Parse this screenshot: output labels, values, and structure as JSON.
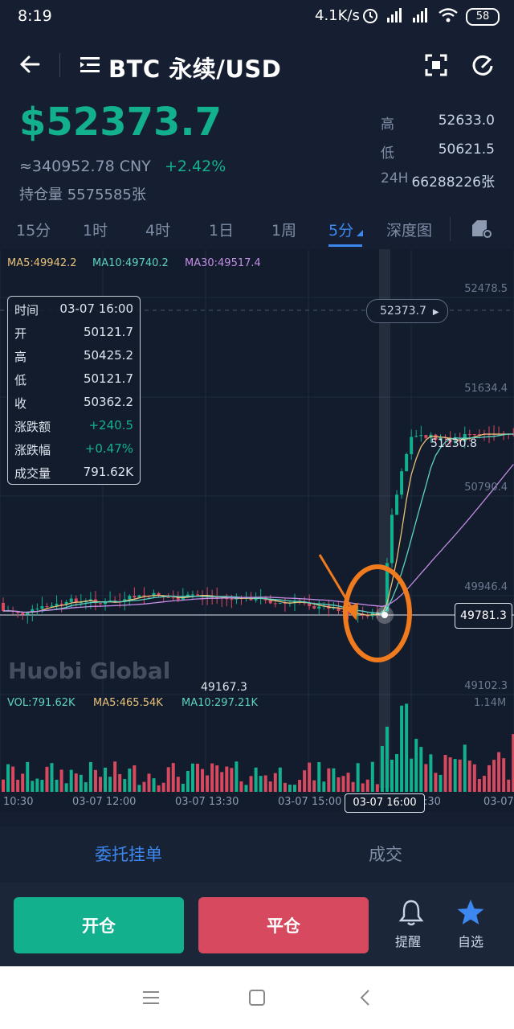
{
  "status": {
    "time": "8:19",
    "net_speed": "4.1K/s",
    "battery": "58"
  },
  "header": {
    "title": "BTC 永续/USD"
  },
  "ticker": {
    "price": "$52373.7",
    "cny": "≈340952.78 CNY",
    "change": "+2.42%",
    "open_interest": "持仓量 5575585张",
    "high_label": "高",
    "high": "52633.0",
    "low_label": "低",
    "low": "50621.5",
    "vol_label": "24H",
    "vol": "66288226张"
  },
  "tabs": [
    {
      "label": "15分"
    },
    {
      "label": "1时"
    },
    {
      "label": "4时"
    },
    {
      "label": "1日"
    },
    {
      "label": "1周"
    },
    {
      "label": "5分"
    },
    {
      "label": "深度图"
    }
  ],
  "ma": {
    "ma5": "MA5:49942.2",
    "ma10": "MA10:49740.2",
    "ma30": "MA30:49517.4"
  },
  "vol_ma": {
    "vol": "VOL:791.62K",
    "ma5": "MA5:465.54K",
    "ma10": "MA10:297.21K"
  },
  "axis": {
    "price_ticks": [
      "52478.5",
      "51634.4",
      "50790.4",
      "49946.4",
      "49102.3"
    ],
    "vol_max": "1.14M",
    "time_ticks": [
      "10:30",
      "03-07 12:00",
      "03-07 13:30",
      "03-07 15:00",
      ":30",
      "03-07"
    ],
    "cursor_time": "03-07 16:00",
    "cursor_price": "49781.3",
    "last_price": "52373.7",
    "max_label": "51230.8",
    "min_label": "49167.3"
  },
  "watermark": "Huobi Global",
  "info": [
    {
      "k": "时间",
      "v": "03-07 16:00",
      "g": false
    },
    {
      "k": "开",
      "v": "50121.7",
      "g": false
    },
    {
      "k": "高",
      "v": "50425.2",
      "g": false
    },
    {
      "k": "低",
      "v": "50121.7",
      "g": false
    },
    {
      "k": "收",
      "v": "50362.2",
      "g": false
    },
    {
      "k": "涨跌额",
      "v": "+240.5",
      "g": true
    },
    {
      "k": "涨跌幅",
      "v": "+0.47%",
      "g": true
    },
    {
      "k": "成交量",
      "v": "791.62K",
      "g": false
    }
  ],
  "bottom_tabs": {
    "orders": "委托挂单",
    "trades": "成交"
  },
  "actions": {
    "open": "开仓",
    "close": "平仓",
    "alert": "提醒",
    "watch": "自选"
  },
  "colors": {
    "up": "#13b08e",
    "down": "#d6495f",
    "accent": "#3d88f0",
    "annotation": "#f07a1e"
  }
}
